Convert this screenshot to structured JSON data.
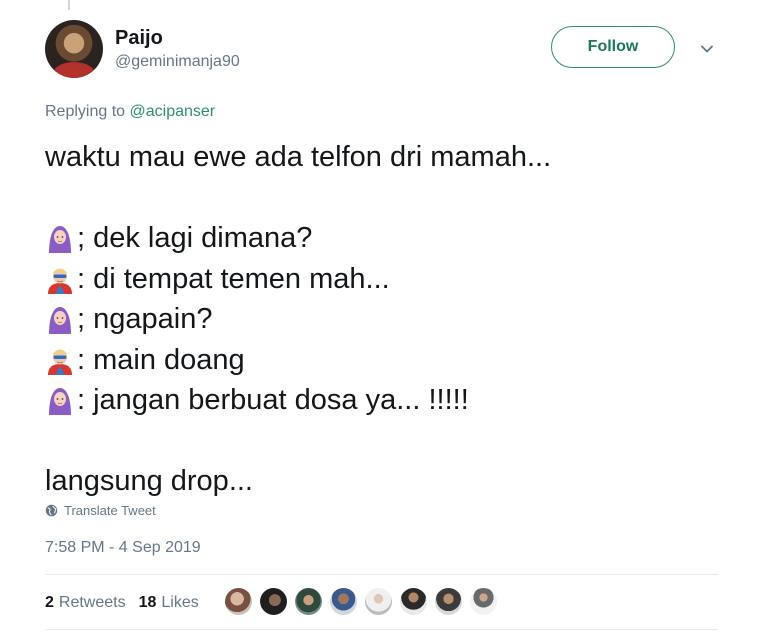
{
  "author": {
    "display_name": "Paijo",
    "username": "@geminimanja90"
  },
  "follow_label": "Follow",
  "replying_to": {
    "prefix": "Replying to ",
    "handle": "@acipanser"
  },
  "tweet": {
    "line1": "waktu mau ewe ada telfon dri mamah...",
    "line3": "; dek lagi dimana?",
    "line4": ": di tempat temen mah...",
    "line5": "; ngapain?",
    "line6": ": main doang",
    "line7": ": jangan berbuat dosa ya... !!!!!",
    "line9": "langsung drop..."
  },
  "translate_label": "Translate Tweet",
  "timestamp": "7:58 PM - 4 Sep 2019",
  "stats": {
    "retweets_count": "2",
    "retweets_label": "Retweets",
    "likes_count": "18",
    "likes_label": "Likes"
  },
  "icons": {
    "caret": "chevron-down-icon",
    "globe": "globe-icon",
    "woman_headscarf": "woman-with-headscarf-emoji",
    "superhero": "man-superhero-emoji"
  },
  "colors": {
    "follow_accent": "#2f8f6c",
    "handle_link": "#2f8f6c",
    "secondary_text": "#657786",
    "primary_text": "#14171a"
  }
}
